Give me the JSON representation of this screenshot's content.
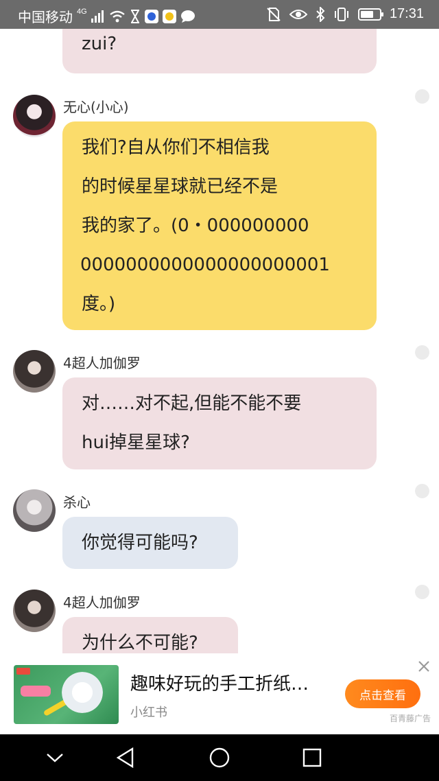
{
  "status_bar": {
    "carrier": "中国移动",
    "network": "4G",
    "time": "17:31",
    "battery_level": 0.7,
    "icons": [
      "signal-icon",
      "wifi-icon",
      "hourglass-icon",
      "baidu-app-icon",
      "smile-app-icon",
      "chat-icon",
      "no-sim-icon",
      "eye-icon",
      "bluetooth-icon",
      "vibrate-icon",
      "battery-icon"
    ]
  },
  "chat": {
    "messages": [
      {
        "lines": [
          "zui?"
        ]
      },
      {
        "sender": "无心(小心)",
        "lines": [
          "我们?自从你们不相信我",
          "的时候星星球就已经不是",
          "我的家了。(0・000000000",
          "0000000000000000000001",
          "度。)"
        ]
      },
      {
        "sender": "4超人加伽罗",
        "lines": [
          "对……对不起,但能不能不要",
          "hui掉星星球?"
        ]
      },
      {
        "sender": "杀心",
        "lines": [
          "你觉得可能吗?"
        ]
      },
      {
        "sender": "4超人加伽罗",
        "lines": [
          "为什么不可能?"
        ]
      }
    ]
  },
  "ad": {
    "title": "趣味好玩的手工折纸…",
    "source": "小红书",
    "button_label": "点击查看",
    "close_icon": "close-icon",
    "label": "百青藤广告"
  },
  "nav_bar": {
    "icons": [
      "chevron-down-icon",
      "back-triangle-icon",
      "home-circle-icon",
      "recents-square-icon"
    ]
  }
}
